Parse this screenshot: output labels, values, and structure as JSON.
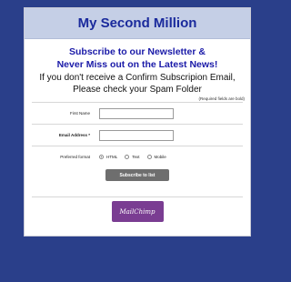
{
  "header": {
    "title": "My Second Million"
  },
  "intro": {
    "headline_line1": "Subscribe to our Newsletter &",
    "headline_line2": "Never Miss out on the Latest News!",
    "notice_line1": "If you don't receive a Confirm Subscripion Email,",
    "notice_line2": "Please check your Spam Folder"
  },
  "form": {
    "required_note": "(Required fields are bold)",
    "first_name": {
      "label": "First Name",
      "value": ""
    },
    "email": {
      "label": "Email Address *",
      "value": ""
    },
    "format": {
      "label": "Preferred format",
      "options": [
        "HTML",
        "Text",
        "Mobile"
      ],
      "selected": "HTML"
    },
    "submit_label": "Subscribe to list"
  },
  "footer": {
    "badge_text": "MailChimp"
  },
  "colors": {
    "background": "#2a3f8a",
    "title": "#1a2a9c",
    "badge": "#7a3d92"
  }
}
